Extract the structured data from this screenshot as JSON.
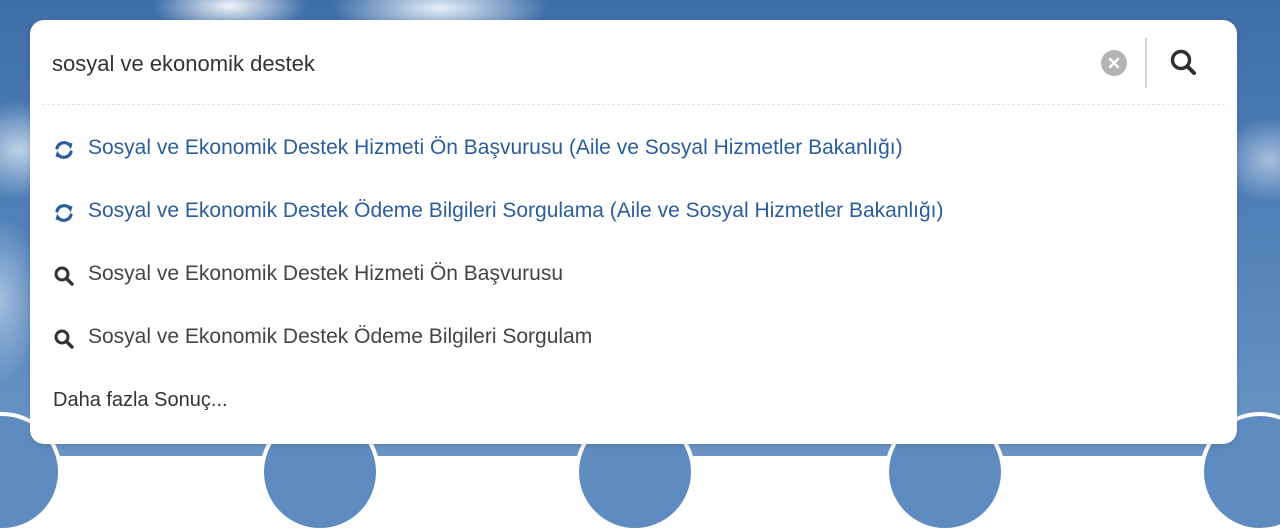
{
  "search": {
    "query": "sosyal ve ekonomik destek",
    "clear_icon": "close-circle-icon",
    "submit_icon": "search-icon"
  },
  "suggestions": [
    {
      "type": "service",
      "icon": "refresh-icon",
      "label": "Sosyal ve Ekonomik Destek Hizmeti Ön Başvurusu (Aile ve Sosyal Hizmetler Bakanlığı)"
    },
    {
      "type": "service",
      "icon": "refresh-icon",
      "label": "Sosyal ve Ekonomik Destek Ödeme Bilgileri Sorgulama (Aile ve Sosyal Hizmetler Bakanlığı)"
    },
    {
      "type": "query",
      "icon": "search-icon",
      "label": "Sosyal ve Ekonomik Destek Hizmeti Ön Başvurusu"
    },
    {
      "type": "query",
      "icon": "search-icon",
      "label": "Sosyal ve Ekonomik Destek Ödeme Bilgileri Sorgulam"
    }
  ],
  "more_results": "Daha fazla Sonuç...",
  "colors": {
    "service_link": "#2b5d9b",
    "query_text": "#444444",
    "icon_blue": "#2b5d9b",
    "icon_dark": "#333333",
    "background_sky": "#4d7db6"
  }
}
